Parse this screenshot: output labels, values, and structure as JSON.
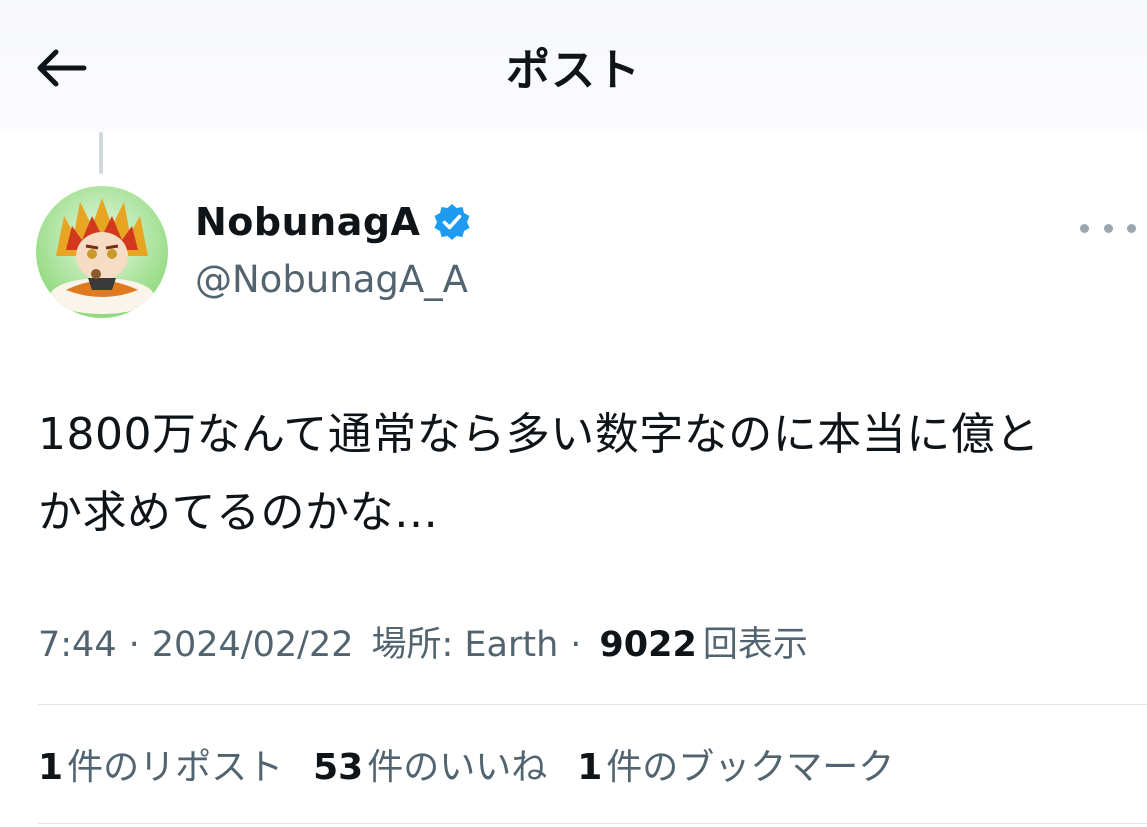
{
  "header": {
    "title": "ポスト",
    "back_icon": "arrow-left-icon"
  },
  "author": {
    "name": "NobunagA",
    "handle": "@NobunagA_A",
    "verified": true,
    "verified_color": "#1d9bf0"
  },
  "tweet": {
    "text_line1": "1800万なんて通常なら多い数字なのに本当に億と",
    "text_line2": "か求めてるのかな…"
  },
  "meta": {
    "time": "7:44",
    "separator": "·",
    "date": "2024/02/22",
    "location": "場所: Earth",
    "views_count": "9022",
    "views_label": "回表示"
  },
  "stats": {
    "reposts_count": "1",
    "reposts_label": "件のリポスト",
    "likes_count": "53",
    "likes_label": "件のいいね",
    "bookmarks_count": "1",
    "bookmarks_label": "件のブックマーク"
  }
}
